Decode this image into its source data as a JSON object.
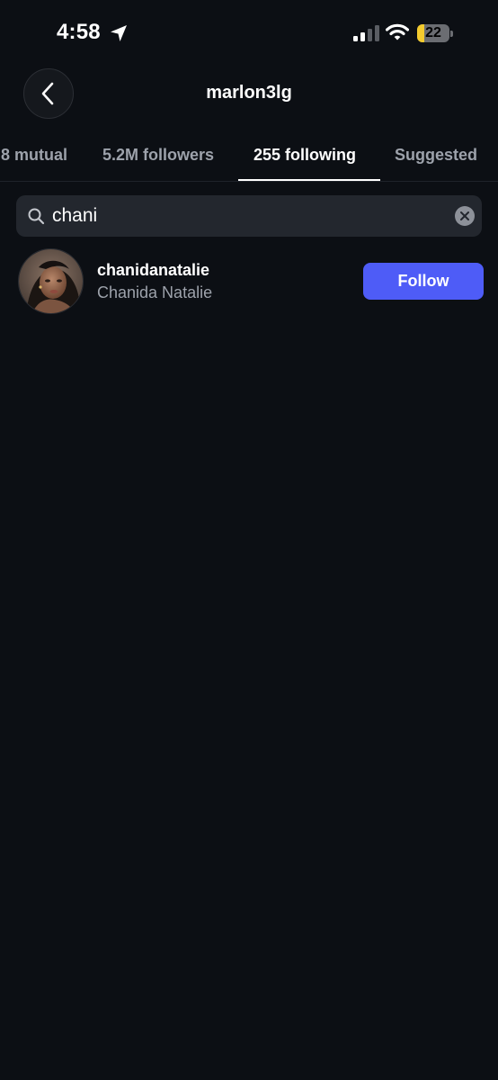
{
  "status_bar": {
    "time": "4:58",
    "battery": "22",
    "battery_level": 0.22
  },
  "header": {
    "title": "marlon3lg",
    "back_icon": "chevron-left-icon"
  },
  "tabs": [
    {
      "label": "8 mutual",
      "active": false
    },
    {
      "label": "5.2M followers",
      "active": false
    },
    {
      "label": "255 following",
      "active": true
    },
    {
      "label": "Suggested",
      "active": false
    }
  ],
  "search": {
    "value": "chani",
    "icon": "search-icon",
    "clear_icon": "clear-icon"
  },
  "results": [
    {
      "username": "chanidanatalie",
      "display_name": "Chanida Natalie",
      "button_label": "Follow"
    }
  ],
  "colors": {
    "background": "#0c0f14",
    "accent": "#4e5cf7",
    "battery": "#f4cb2e",
    "secondary_text": "#9da2ab"
  }
}
